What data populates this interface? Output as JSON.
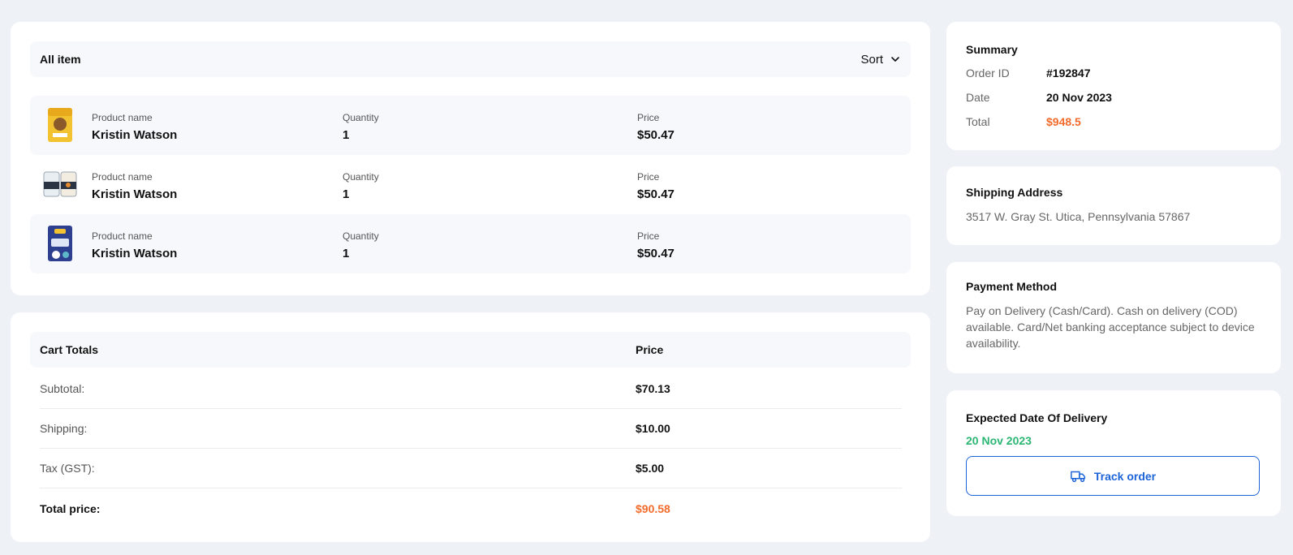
{
  "items": {
    "title": "All item",
    "sort_label": "Sort",
    "rows": [
      {
        "name_label": "Product name",
        "name": "Kristin Watson",
        "qty_label": "Quantity",
        "qty": "1",
        "price_label": "Price",
        "price": "$50.47",
        "thumb": "product-bag-yellow"
      },
      {
        "name_label": "Product name",
        "name": "Kristin Watson",
        "qty_label": "Quantity",
        "qty": "1",
        "price_label": "Price",
        "price": "$50.47",
        "thumb": "product-jars"
      },
      {
        "name_label": "Product name",
        "name": "Kristin Watson",
        "qty_label": "Quantity",
        "qty": "1",
        "price_label": "Price",
        "price": "$50.47",
        "thumb": "product-bag-blue"
      }
    ]
  },
  "totals": {
    "title": "Cart Totals",
    "price_header": "Price",
    "rows": [
      {
        "label": "Subtotal:",
        "value": "$70.13"
      },
      {
        "label": "Shipping:",
        "value": "$10.00"
      },
      {
        "label": "Tax (GST):",
        "value": "$5.00"
      },
      {
        "label": "Total price:",
        "value": "$90.58"
      }
    ]
  },
  "summary": {
    "title": "Summary",
    "order_id_label": "Order ID",
    "order_id": "#192847",
    "date_label": "Date",
    "date": "20 Nov 2023",
    "total_label": "Total",
    "total": "$948.5"
  },
  "shipping": {
    "title": "Shipping Address",
    "address": "3517 W. Gray St. Utica, Pennsylvania 57867"
  },
  "payment": {
    "title": "Payment Method",
    "text": "Pay on Delivery (Cash/Card). Cash on delivery (COD) available. Card/Net banking acceptance subject to device availability."
  },
  "delivery": {
    "title": "Expected Date Of Delivery",
    "date": "20 Nov 2023",
    "track_label": "Track order",
    "track_icon": "truck-icon"
  },
  "colors": {
    "accent_blue": "#1d64d8",
    "accent_orange": "#f26b2a",
    "accent_green": "#2bb673",
    "page_bg": "#eef2f7",
    "row_bg": "#f6f8fb"
  }
}
